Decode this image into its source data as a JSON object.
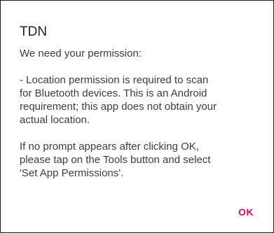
{
  "dialog": {
    "title": "TDN",
    "intro": "We need your permission:",
    "para1_lines": [
      "- Location permission is required to scan",
      "for Bluetooth devices. This is an Android",
      "requirement; this app does not obtain your",
      "actual location."
    ],
    "para2_lines": [
      "If no prompt appears after clicking OK,",
      "please tap on the Tools button and select",
      "'Set App Permissions'."
    ],
    "ok_label": "OK",
    "accent_color": "#c2185b"
  }
}
